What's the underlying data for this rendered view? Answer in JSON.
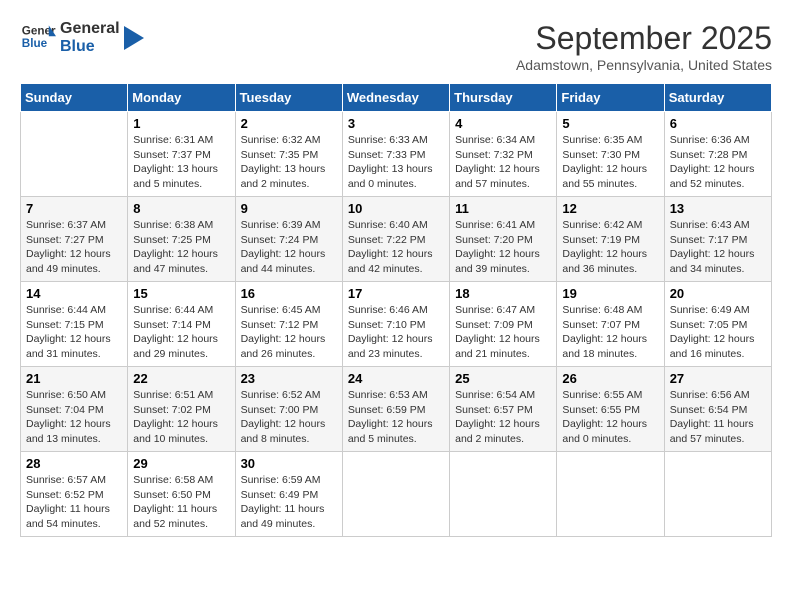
{
  "app": {
    "name": "GeneralBlue",
    "logo_line1": "General",
    "logo_line2": "Blue"
  },
  "calendar": {
    "month": "September 2025",
    "location": "Adamstown, Pennsylvania, United States",
    "days_of_week": [
      "Sunday",
      "Monday",
      "Tuesday",
      "Wednesday",
      "Thursday",
      "Friday",
      "Saturday"
    ],
    "weeks": [
      [
        {
          "day": "",
          "info": ""
        },
        {
          "day": "1",
          "info": "Sunrise: 6:31 AM\nSunset: 7:37 PM\nDaylight: 13 hours\nand 5 minutes."
        },
        {
          "day": "2",
          "info": "Sunrise: 6:32 AM\nSunset: 7:35 PM\nDaylight: 13 hours\nand 2 minutes."
        },
        {
          "day": "3",
          "info": "Sunrise: 6:33 AM\nSunset: 7:33 PM\nDaylight: 13 hours\nand 0 minutes."
        },
        {
          "day": "4",
          "info": "Sunrise: 6:34 AM\nSunset: 7:32 PM\nDaylight: 12 hours\nand 57 minutes."
        },
        {
          "day": "5",
          "info": "Sunrise: 6:35 AM\nSunset: 7:30 PM\nDaylight: 12 hours\nand 55 minutes."
        },
        {
          "day": "6",
          "info": "Sunrise: 6:36 AM\nSunset: 7:28 PM\nDaylight: 12 hours\nand 52 minutes."
        }
      ],
      [
        {
          "day": "7",
          "info": "Sunrise: 6:37 AM\nSunset: 7:27 PM\nDaylight: 12 hours\nand 49 minutes."
        },
        {
          "day": "8",
          "info": "Sunrise: 6:38 AM\nSunset: 7:25 PM\nDaylight: 12 hours\nand 47 minutes."
        },
        {
          "day": "9",
          "info": "Sunrise: 6:39 AM\nSunset: 7:24 PM\nDaylight: 12 hours\nand 44 minutes."
        },
        {
          "day": "10",
          "info": "Sunrise: 6:40 AM\nSunset: 7:22 PM\nDaylight: 12 hours\nand 42 minutes."
        },
        {
          "day": "11",
          "info": "Sunrise: 6:41 AM\nSunset: 7:20 PM\nDaylight: 12 hours\nand 39 minutes."
        },
        {
          "day": "12",
          "info": "Sunrise: 6:42 AM\nSunset: 7:19 PM\nDaylight: 12 hours\nand 36 minutes."
        },
        {
          "day": "13",
          "info": "Sunrise: 6:43 AM\nSunset: 7:17 PM\nDaylight: 12 hours\nand 34 minutes."
        }
      ],
      [
        {
          "day": "14",
          "info": "Sunrise: 6:44 AM\nSunset: 7:15 PM\nDaylight: 12 hours\nand 31 minutes."
        },
        {
          "day": "15",
          "info": "Sunrise: 6:44 AM\nSunset: 7:14 PM\nDaylight: 12 hours\nand 29 minutes."
        },
        {
          "day": "16",
          "info": "Sunrise: 6:45 AM\nSunset: 7:12 PM\nDaylight: 12 hours\nand 26 minutes."
        },
        {
          "day": "17",
          "info": "Sunrise: 6:46 AM\nSunset: 7:10 PM\nDaylight: 12 hours\nand 23 minutes."
        },
        {
          "day": "18",
          "info": "Sunrise: 6:47 AM\nSunset: 7:09 PM\nDaylight: 12 hours\nand 21 minutes."
        },
        {
          "day": "19",
          "info": "Sunrise: 6:48 AM\nSunset: 7:07 PM\nDaylight: 12 hours\nand 18 minutes."
        },
        {
          "day": "20",
          "info": "Sunrise: 6:49 AM\nSunset: 7:05 PM\nDaylight: 12 hours\nand 16 minutes."
        }
      ],
      [
        {
          "day": "21",
          "info": "Sunrise: 6:50 AM\nSunset: 7:04 PM\nDaylight: 12 hours\nand 13 minutes."
        },
        {
          "day": "22",
          "info": "Sunrise: 6:51 AM\nSunset: 7:02 PM\nDaylight: 12 hours\nand 10 minutes."
        },
        {
          "day": "23",
          "info": "Sunrise: 6:52 AM\nSunset: 7:00 PM\nDaylight: 12 hours\nand 8 minutes."
        },
        {
          "day": "24",
          "info": "Sunrise: 6:53 AM\nSunset: 6:59 PM\nDaylight: 12 hours\nand 5 minutes."
        },
        {
          "day": "25",
          "info": "Sunrise: 6:54 AM\nSunset: 6:57 PM\nDaylight: 12 hours\nand 2 minutes."
        },
        {
          "day": "26",
          "info": "Sunrise: 6:55 AM\nSunset: 6:55 PM\nDaylight: 12 hours\nand 0 minutes."
        },
        {
          "day": "27",
          "info": "Sunrise: 6:56 AM\nSunset: 6:54 PM\nDaylight: 11 hours\nand 57 minutes."
        }
      ],
      [
        {
          "day": "28",
          "info": "Sunrise: 6:57 AM\nSunset: 6:52 PM\nDaylight: 11 hours\nand 54 minutes."
        },
        {
          "day": "29",
          "info": "Sunrise: 6:58 AM\nSunset: 6:50 PM\nDaylight: 11 hours\nand 52 minutes."
        },
        {
          "day": "30",
          "info": "Sunrise: 6:59 AM\nSunset: 6:49 PM\nDaylight: 11 hours\nand 49 minutes."
        },
        {
          "day": "",
          "info": ""
        },
        {
          "day": "",
          "info": ""
        },
        {
          "day": "",
          "info": ""
        },
        {
          "day": "",
          "info": ""
        }
      ]
    ]
  }
}
